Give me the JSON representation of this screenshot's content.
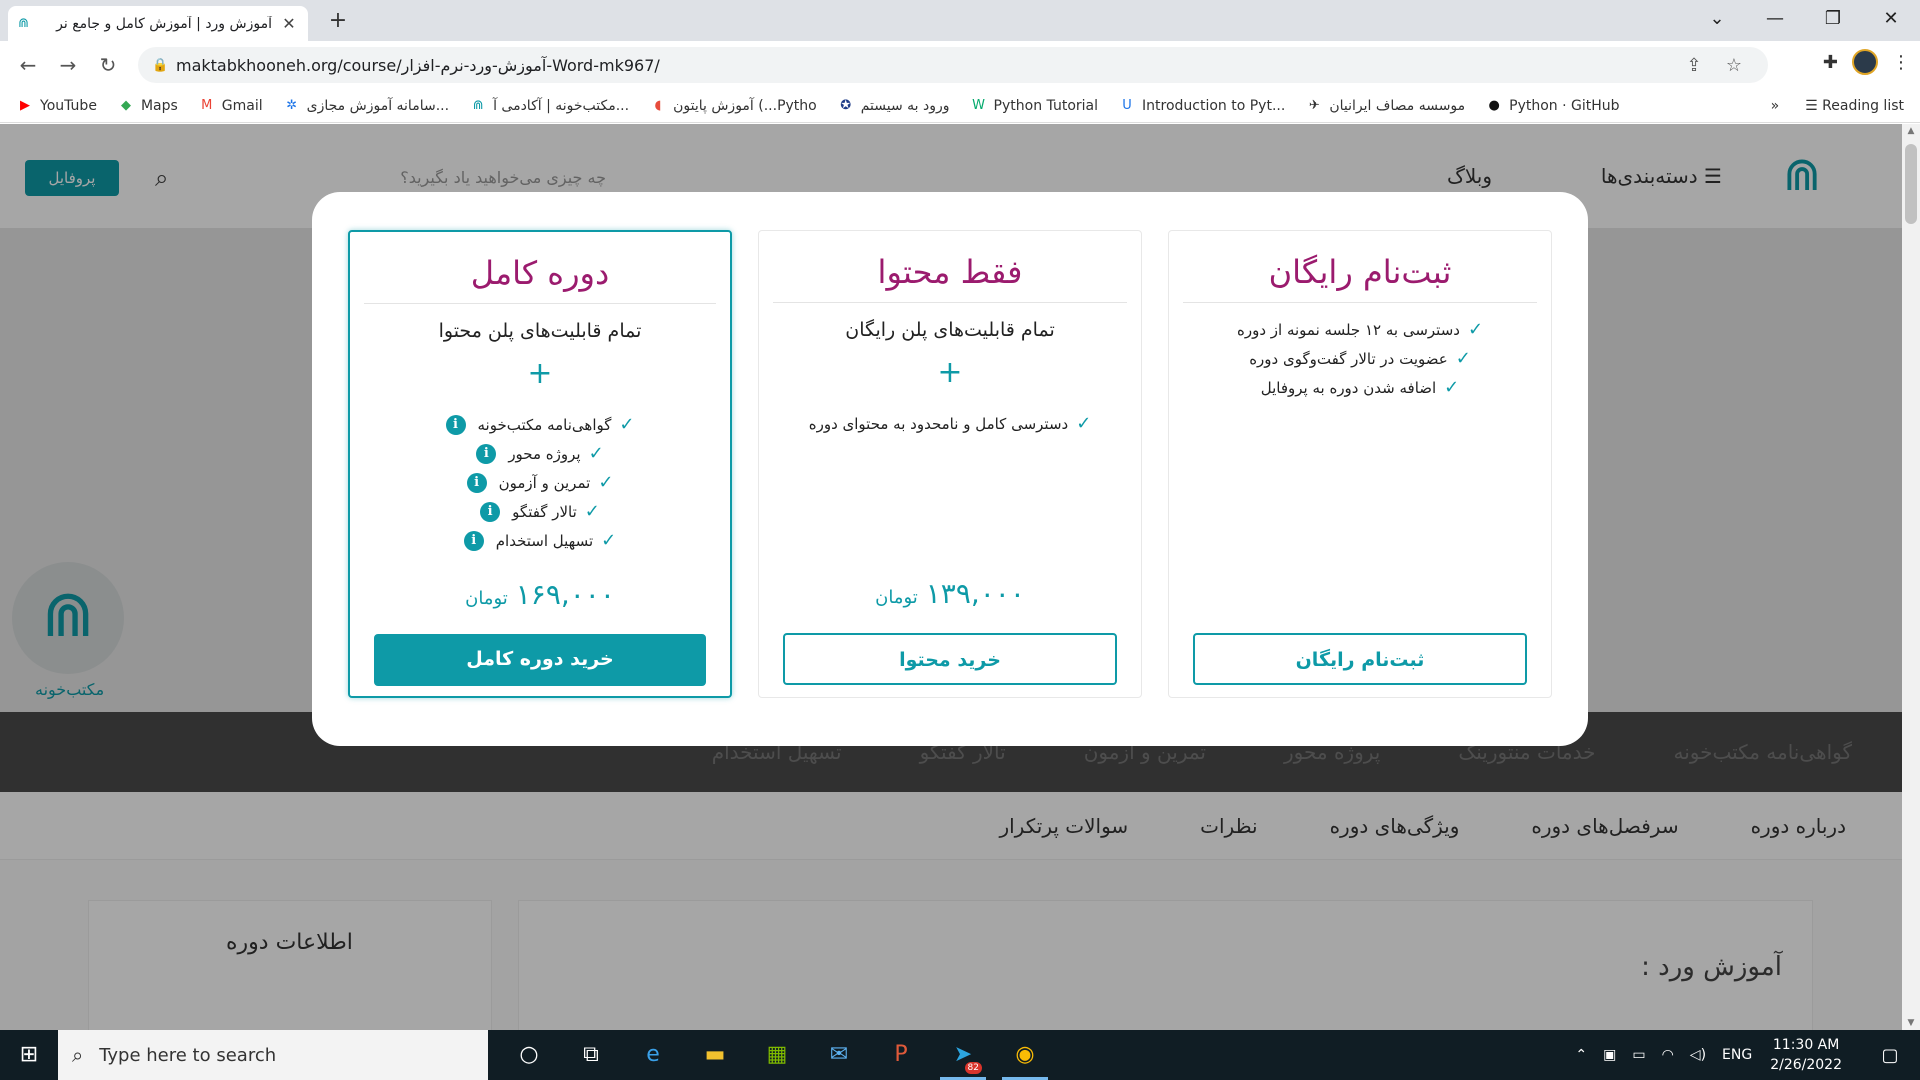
{
  "browser": {
    "tab_title": "آموزش ورد | آموزش کامل و جامع نر",
    "tab_close": "✕",
    "new_tab": "+",
    "url": "maktabkhooneh.org/course/آموزش-ورد-نرم-افزار-Word-mk967/",
    "window_controls": [
      "⌄",
      "—",
      "❐",
      "✕"
    ]
  },
  "bookmarks": [
    {
      "label": "YouTube",
      "icon": "youtube-icon",
      "color": "#ff0000"
    },
    {
      "label": "Maps",
      "icon": "maps-icon",
      "color": "#34a853"
    },
    {
      "label": "Gmail",
      "icon": "gmail-icon",
      "color": "#ea4335"
    },
    {
      "label": "سامانه آموزش مجازی...",
      "icon": "site-icon",
      "color": "#1a73e8"
    },
    {
      "label": "مکتب‌خونه | آکادمی آ...",
      "icon": "maktab-icon",
      "color": "#0e9aa7"
    },
    {
      "label": "آموزش پایتون (...Pytho",
      "icon": "python-icon",
      "color": "#e74c3c"
    },
    {
      "label": "ورود به سیستم",
      "icon": "login-icon",
      "color": "#1f3c88"
    },
    {
      "label": "Python Tutorial",
      "icon": "w3-icon",
      "color": "#04aa6d"
    },
    {
      "label": "Introduction to Pyt...",
      "icon": "udemy-icon",
      "color": "#1a73e8"
    },
    {
      "label": "موسسه مصاف ایرانیان",
      "icon": "masaf-icon",
      "color": "#333333"
    },
    {
      "label": "Python · GitHub",
      "icon": "github-icon",
      "color": "#111111"
    }
  ],
  "bookmarks_more": "»",
  "reading_list": "Reading list",
  "site": {
    "categories": "دسته‌بندی‌ها",
    "blog": "وبلاگ",
    "search_placeholder": "چه چیزی می‌خواهید یاد بگیرید؟",
    "profile": "پروفایل",
    "logo_text": "مکتب‌خونه"
  },
  "features_strip": [
    "گواهی‌نامه مکتب‌خونه",
    "خدمات منتورینگ",
    "پروژه محور",
    "تمرین و آزمون",
    "تالار گفتگو",
    "تسهیل استخدام"
  ],
  "course_tabs": [
    "درباره دوره",
    "سرفصل‌های دوره",
    "ویژگی‌های دوره",
    "نظرات",
    "سوالات پرتکرار"
  ],
  "info_title": "اطلاعات دوره",
  "main_title": "آموزش ورد :",
  "plans": {
    "free": {
      "title": "ثبت‌نام رایگان",
      "features": [
        "دسترسی به ۱۲ جلسه نمونه از دوره",
        "عضویت در تالار گفت‌وگوی دوره",
        "اضافه شدن دوره به پروفایل"
      ],
      "button": "ثبت‌نام رایگان"
    },
    "content": {
      "title": "فقط محتوا",
      "subtitle": "تمام قابلیت‌های پلن رایگان",
      "plus": "+",
      "features": [
        "دسترسی کامل و نامحدود به محتوای دوره"
      ],
      "price": "۱۳۹,۰۰۰",
      "currency": "تومان",
      "button": "خرید محتوا"
    },
    "full": {
      "title": "دوره کامل",
      "subtitle": "تمام قابلیت‌های پلن محتوا",
      "plus": "+",
      "features": [
        "گواهی‌نامه مکتب‌خونه",
        "پروژه محور",
        "تمرین و آزمون",
        "تالار گفتگو",
        "تسهیل استخدام"
      ],
      "price": "۱۶۹,۰۰۰",
      "currency": "تومان",
      "button": "خرید دوره کامل"
    }
  },
  "taskbar": {
    "search_placeholder": "Type here to search",
    "telegram_badge": "82",
    "lang": "ENG",
    "time": "11:30 AM",
    "date": "2/26/2022"
  },
  "colors": {
    "accent": "#0e9aa7",
    "plan_title": "#9b1b6e"
  }
}
